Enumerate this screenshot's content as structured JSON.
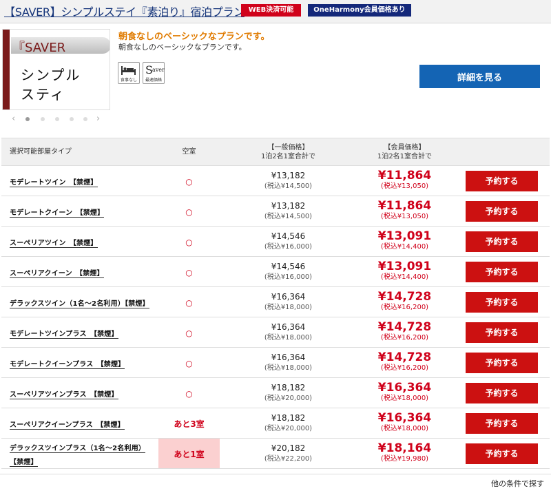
{
  "plan": {
    "title": "【SAVER】シンプルステイ『素泊り』宿泊プラン",
    "badges": {
      "web": "WEB決済可能",
      "oneharmony": "OneHarmony会員価格あり"
    },
    "carousel": {
      "saver_text": "『SAVER",
      "line1": "シンプル",
      "line2": "スティ",
      "prev": "‹",
      "next": "›",
      "slides": 5,
      "active_slide": 1
    },
    "description_heading": "朝食なしのベーシックなプランです。",
    "description_body": "朝食なしのベーシックなプランです。",
    "icons": [
      {
        "icon": "bed-icon",
        "caption": "食事なし"
      },
      {
        "icon": "saver-icon",
        "mark": "S",
        "text": "aver",
        "caption": "最適価格"
      }
    ],
    "details_button": "詳細を見る"
  },
  "table": {
    "headers": {
      "room": "選択可能部屋タイプ",
      "vacancy": "空室",
      "general_1": "【一般価格】",
      "general_2": "1泊2名1室合計で",
      "member_1": "【会員価格】",
      "member_2": "1泊2名1室合計で"
    },
    "book_label": "予約する",
    "rows": [
      {
        "room": "モデレートツイン　【禁煙】",
        "vacancy": "○",
        "general": "¥13,182",
        "general_tax": "(税込¥14,500)",
        "member": "¥11,864",
        "member_tax": "(税込¥13,050)"
      },
      {
        "room": "モデレートクイーン　【禁煙】",
        "vacancy": "○",
        "general": "¥13,182",
        "general_tax": "(税込¥14,500)",
        "member": "¥11,864",
        "member_tax": "(税込¥13,050)"
      },
      {
        "room": "スーペリアツイン　【禁煙】",
        "vacancy": "○",
        "general": "¥14,546",
        "general_tax": "(税込¥16,000)",
        "member": "¥13,091",
        "member_tax": "(税込¥14,400)"
      },
      {
        "room": "スーペリアクイーン　【禁煙】",
        "vacancy": "○",
        "general": "¥14,546",
        "general_tax": "(税込¥16,000)",
        "member": "¥13,091",
        "member_tax": "(税込¥14,400)"
      },
      {
        "room": "デラックスツイン（1名〜2名利用）【禁煙】",
        "vacancy": "○",
        "general": "¥16,364",
        "general_tax": "(税込¥18,000)",
        "member": "¥14,728",
        "member_tax": "(税込¥16,200)"
      },
      {
        "room": "モデレートツインプラス　【禁煙】",
        "vacancy": "○",
        "general": "¥16,364",
        "general_tax": "(税込¥18,000)",
        "member": "¥14,728",
        "member_tax": "(税込¥16,200)"
      },
      {
        "room": "モデレートクイーンプラス　【禁煙】",
        "vacancy": "○",
        "general": "¥16,364",
        "general_tax": "(税込¥18,000)",
        "member": "¥14,728",
        "member_tax": "(税込¥16,200)"
      },
      {
        "room": "スーペリアツインプラス　【禁煙】",
        "vacancy": "○",
        "general": "¥18,182",
        "general_tax": "(税込¥20,000)",
        "member": "¥16,364",
        "member_tax": "(税込¥18,000)"
      },
      {
        "room": "スーペリアクイーンプラス　【禁煙】",
        "vacancy": "あと3室",
        "general": "¥18,182",
        "general_tax": "(税込¥20,000)",
        "member": "¥16,364",
        "member_tax": "(税込¥18,000)"
      },
      {
        "room": "デラックスツインプラス（1名〜2名利用）【禁煙】",
        "vacancy": "あと1室",
        "general": "¥20,182",
        "general_tax": "(税込¥22,200)",
        "member": "¥18,164",
        "member_tax": "(税込¥19,980)"
      }
    ]
  },
  "footer": {
    "other_conditions": "他の条件で探す"
  },
  "colors": {
    "accent_red": "#d0021b",
    "navy": "#14287a",
    "button_blue": "#1464b4",
    "heading_orange": "#e07b00"
  }
}
